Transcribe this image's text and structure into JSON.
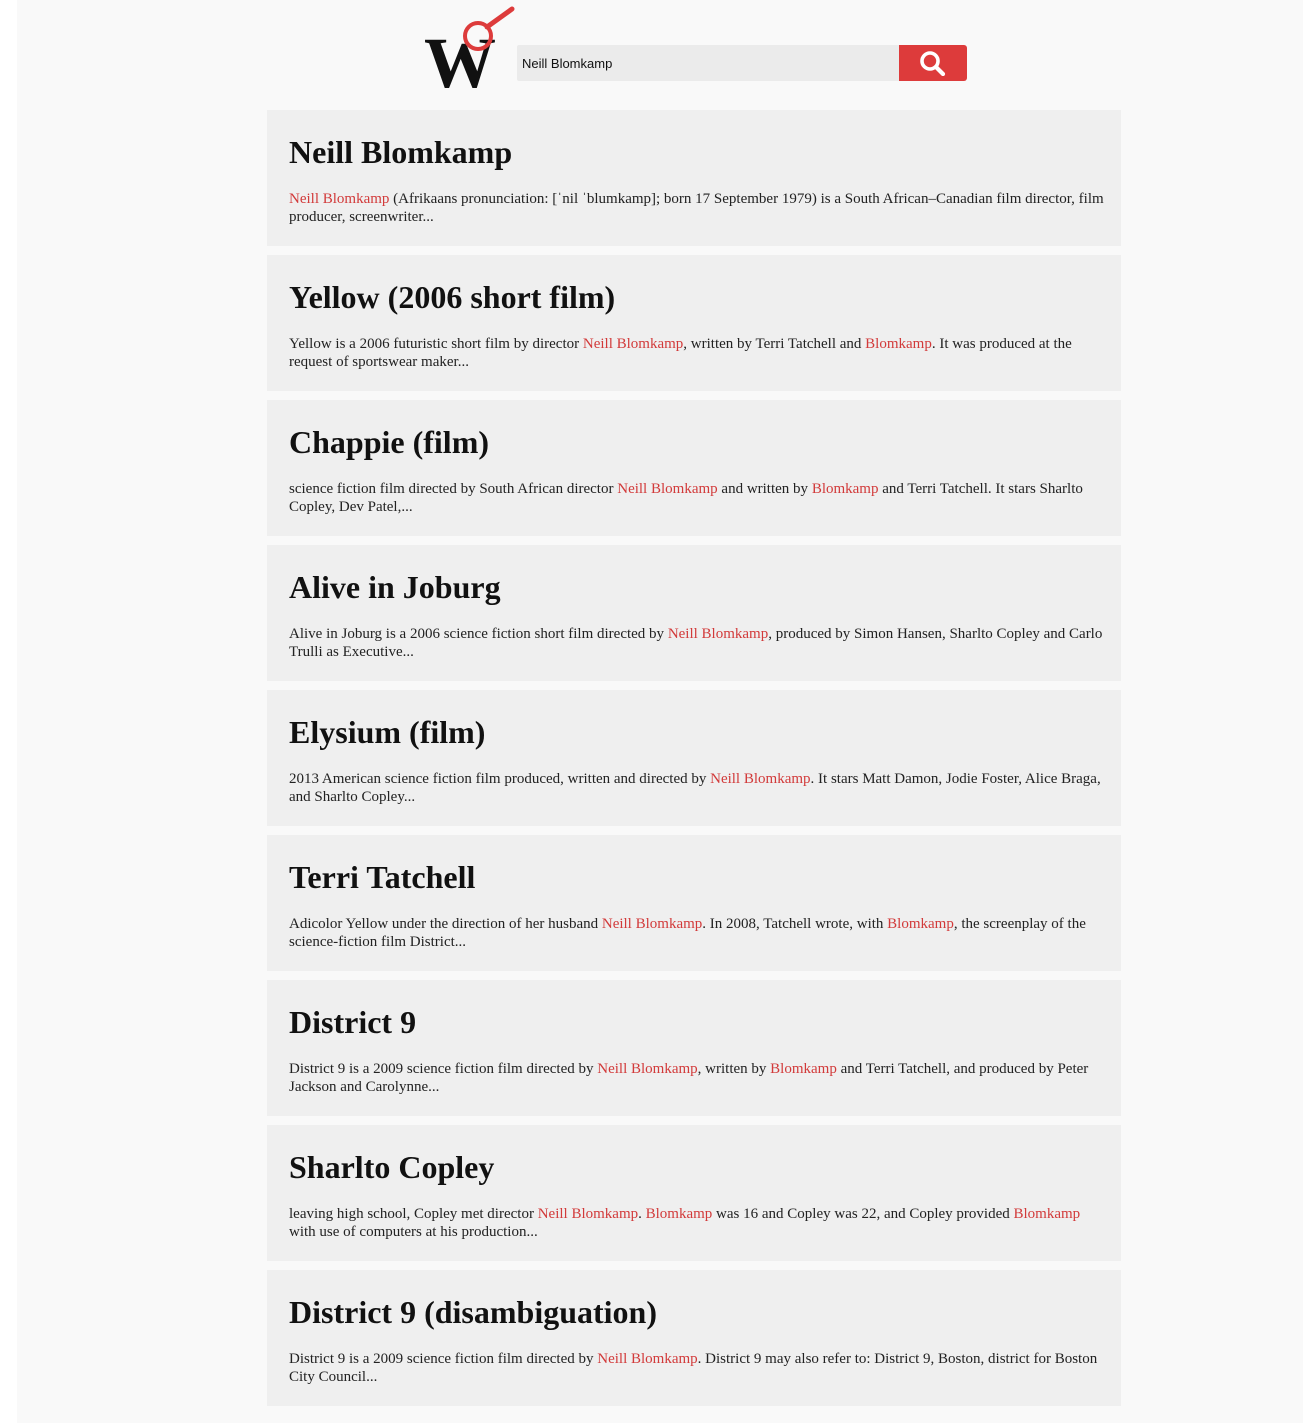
{
  "search": {
    "query": "Neill Blomkamp",
    "button_icon": "search-icon"
  },
  "logo": {
    "letter": "W",
    "icon": "magnifier-icon",
    "accent_color": "#dd3b3b"
  },
  "colors": {
    "accent": "#dd3b3b",
    "highlight_text": "#d23a3a",
    "card_background": "#efefef",
    "page_background": "#f9f9f9"
  },
  "results": [
    {
      "title": "Neill Blomkamp",
      "snippet": [
        {
          "text": "Neill Blomkamp",
          "hl": true
        },
        {
          "text": " (Afrikaans pronunciation: [ˈnil ˈblumkamp]; born 17 September 1979) is a South African–Canadian film director, film producer, screenwriter...",
          "hl": false
        }
      ]
    },
    {
      "title": "Yellow (2006 short film)",
      "snippet": [
        {
          "text": "Yellow is a 2006 futuristic short film by director ",
          "hl": false
        },
        {
          "text": "Neill Blomkamp",
          "hl": true
        },
        {
          "text": ", written by Terri Tatchell and ",
          "hl": false
        },
        {
          "text": "Blomkamp",
          "hl": true
        },
        {
          "text": ". It was produced at the request of sportswear maker...",
          "hl": false
        }
      ]
    },
    {
      "title": "Chappie (film)",
      "snippet": [
        {
          "text": "science fiction film directed by South African director ",
          "hl": false
        },
        {
          "text": "Neill Blomkamp",
          "hl": true
        },
        {
          "text": " and written by ",
          "hl": false
        },
        {
          "text": "Blomkamp",
          "hl": true
        },
        {
          "text": " and Terri Tatchell. It stars Sharlto Copley, Dev Patel,...",
          "hl": false
        }
      ]
    },
    {
      "title": "Alive in Joburg",
      "snippet": [
        {
          "text": "Alive in Joburg is a 2006 science fiction short film directed by ",
          "hl": false
        },
        {
          "text": "Neill Blomkamp",
          "hl": true
        },
        {
          "text": ", produced by Simon Hansen, Sharlto Copley and Carlo Trulli as Executive...",
          "hl": false
        }
      ]
    },
    {
      "title": "Elysium (film)",
      "snippet": [
        {
          "text": "2013 American science fiction film produced, written and directed by ",
          "hl": false
        },
        {
          "text": "Neill Blomkamp",
          "hl": true
        },
        {
          "text": ". It stars Matt Damon, Jodie Foster, Alice Braga, and Sharlto Copley...",
          "hl": false
        }
      ]
    },
    {
      "title": "Terri Tatchell",
      "snippet": [
        {
          "text": "Adicolor Yellow under the direction of her husband ",
          "hl": false
        },
        {
          "text": "Neill Blomkamp",
          "hl": true
        },
        {
          "text": ". In 2008, Tatchell wrote, with ",
          "hl": false
        },
        {
          "text": "Blomkamp",
          "hl": true
        },
        {
          "text": ", the screenplay of the science-fiction film District...",
          "hl": false
        }
      ]
    },
    {
      "title": "District 9",
      "snippet": [
        {
          "text": "District 9 is a 2009 science fiction film directed by ",
          "hl": false
        },
        {
          "text": "Neill Blomkamp",
          "hl": true
        },
        {
          "text": ", written by ",
          "hl": false
        },
        {
          "text": "Blomkamp",
          "hl": true
        },
        {
          "text": " and Terri Tatchell, and produced by Peter Jackson and Carolynne...",
          "hl": false
        }
      ]
    },
    {
      "title": "Sharlto Copley",
      "snippet": [
        {
          "text": "leaving high school, Copley met director ",
          "hl": false
        },
        {
          "text": "Neill Blomkamp",
          "hl": true
        },
        {
          "text": ". ",
          "hl": false
        },
        {
          "text": "Blomkamp",
          "hl": true
        },
        {
          "text": " was 16 and Copley was 22, and Copley provided ",
          "hl": false
        },
        {
          "text": "Blomkamp",
          "hl": true
        },
        {
          "text": " with use of computers at his production...",
          "hl": false
        }
      ]
    },
    {
      "title": "District 9 (disambiguation)",
      "snippet": [
        {
          "text": "District 9 is a 2009 science fiction film directed by ",
          "hl": false
        },
        {
          "text": "Neill Blomkamp",
          "hl": true
        },
        {
          "text": ". District 9 may also refer to: District 9, Boston, district for Boston City Council...",
          "hl": false
        }
      ]
    }
  ]
}
